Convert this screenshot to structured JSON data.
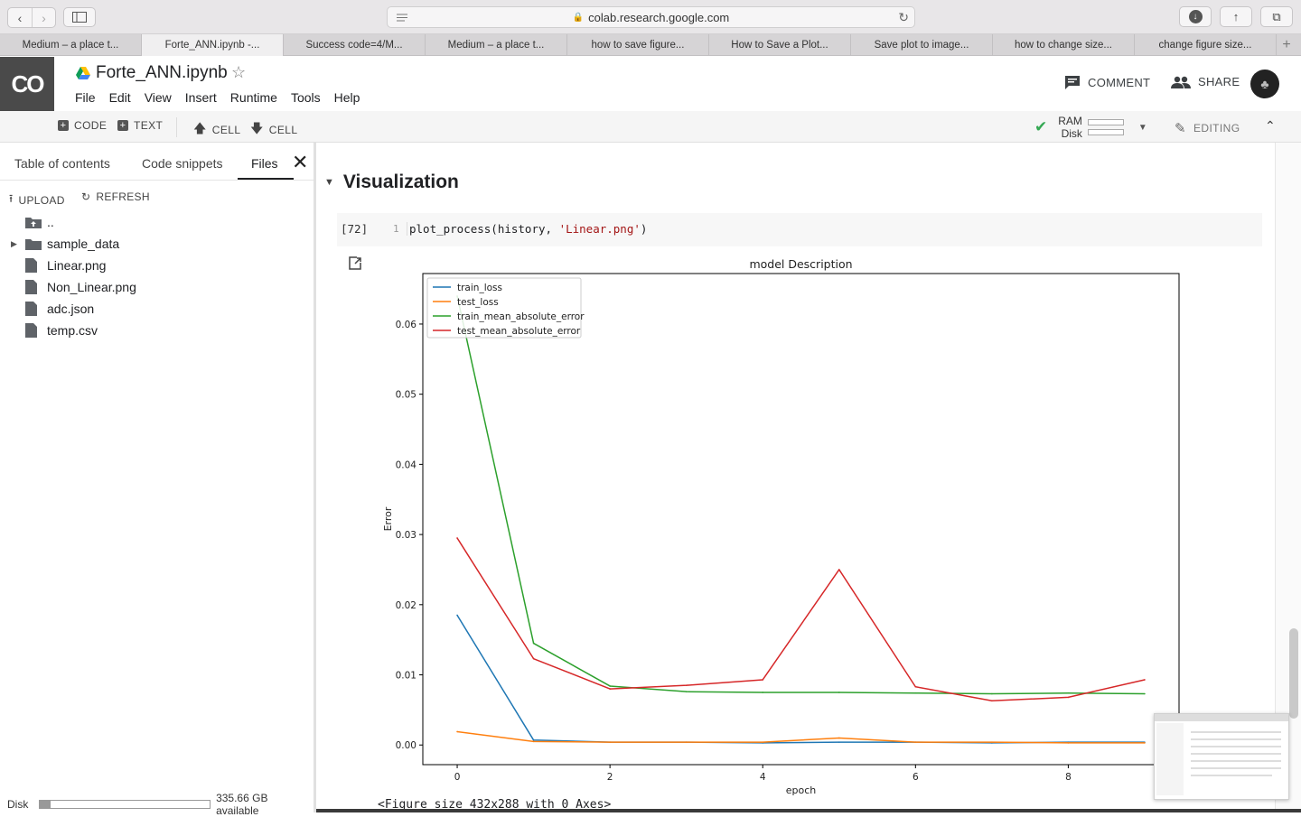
{
  "browser": {
    "url": "colab.research.google.com",
    "tabs": [
      {
        "label": "Medium – a place t...",
        "active": false
      },
      {
        "label": "Forte_ANN.ipynb -...",
        "active": true
      },
      {
        "label": "Success code=4/M...",
        "active": false
      },
      {
        "label": "Medium – a place t...",
        "active": false
      },
      {
        "label": "how to save figure...",
        "active": false
      },
      {
        "label": "How to Save a Plot...",
        "active": false
      },
      {
        "label": "Save plot to image...",
        "active": false
      },
      {
        "label": "how to change size...",
        "active": false
      },
      {
        "label": "change figure size...",
        "active": false
      }
    ]
  },
  "header": {
    "logo": "CO",
    "title": "Forte_ANN.ipynb",
    "menu": [
      "File",
      "Edit",
      "View",
      "Insert",
      "Runtime",
      "Tools",
      "Help"
    ],
    "comment_label": "COMMENT",
    "share_label": "SHARE"
  },
  "toolbar": {
    "code_label": "CODE",
    "text_label": "TEXT",
    "cell_up_label": "CELL",
    "cell_down_label": "CELL",
    "ram_label": "RAM",
    "disk_label": "Disk",
    "editing_label": "EDITING"
  },
  "sidebar": {
    "tabs": [
      "Table of contents",
      "Code snippets",
      "Files"
    ],
    "active_tab": "Files",
    "upload_label": "UPLOAD",
    "refresh_label": "REFRESH",
    "files": [
      {
        "name": "..",
        "type": "parent-folder"
      },
      {
        "name": "sample_data",
        "type": "folder"
      },
      {
        "name": "Linear.png",
        "type": "file"
      },
      {
        "name": "Non_Linear.png",
        "type": "file"
      },
      {
        "name": "adc.json",
        "type": "file"
      },
      {
        "name": "temp.csv",
        "type": "file"
      }
    ],
    "disk_label": "Disk",
    "disk_available": "335.66 GB available",
    "disk_used_fraction": 0.06
  },
  "notebook": {
    "section_title": "Visualization",
    "cell": {
      "exec_count": "[72]",
      "line_number": "1",
      "code_prefix": "plot_process(history, ",
      "code_string": "'Linear.png'",
      "code_suffix": ")"
    },
    "output_text": "<Figure size 432x288 with 0 Axes>"
  },
  "colors": {
    "train_loss": "#1f77b4",
    "test_loss": "#ff7f0e",
    "train_mae": "#2ca02c",
    "test_mae": "#d62728"
  },
  "chart_data": {
    "type": "line",
    "title": "model Description",
    "xlabel": "epoch",
    "ylabel": "Error",
    "xlim": [
      -0.45,
      9.45
    ],
    "ylim": [
      -0.0028,
      0.0672
    ],
    "xticks": [
      0,
      2,
      4,
      6,
      8
    ],
    "yticks": [
      0.0,
      0.01,
      0.02,
      0.03,
      0.04,
      0.05,
      0.06
    ],
    "ytick_labels": [
      "0.00",
      "0.01",
      "0.02",
      "0.03",
      "0.04",
      "0.05",
      "0.06"
    ],
    "x": [
      0,
      1,
      2,
      3,
      4,
      5,
      6,
      7,
      8,
      9
    ],
    "legend_position": "upper-left",
    "series": [
      {
        "name": "train_loss",
        "color": "#1f77b4",
        "values": [
          0.0185,
          0.0007,
          0.0004,
          0.0004,
          0.0003,
          0.0004,
          0.0004,
          0.0003,
          0.0004,
          0.0004
        ]
      },
      {
        "name": "test_loss",
        "color": "#ff7f0e",
        "values": [
          0.0019,
          0.0005,
          0.0004,
          0.0004,
          0.0004,
          0.001,
          0.0004,
          0.0004,
          0.0003,
          0.0003
        ]
      },
      {
        "name": "train_mean_absolute_error",
        "color": "#2ca02c",
        "values": [
          0.064,
          0.0145,
          0.0084,
          0.0076,
          0.0075,
          0.0075,
          0.0074,
          0.0073,
          0.0074,
          0.0073
        ]
      },
      {
        "name": "test_mean_absolute_error",
        "color": "#d62728",
        "values": [
          0.0295,
          0.0123,
          0.008,
          0.0085,
          0.0093,
          0.025,
          0.0083,
          0.0063,
          0.0068,
          0.0093
        ]
      }
    ]
  }
}
